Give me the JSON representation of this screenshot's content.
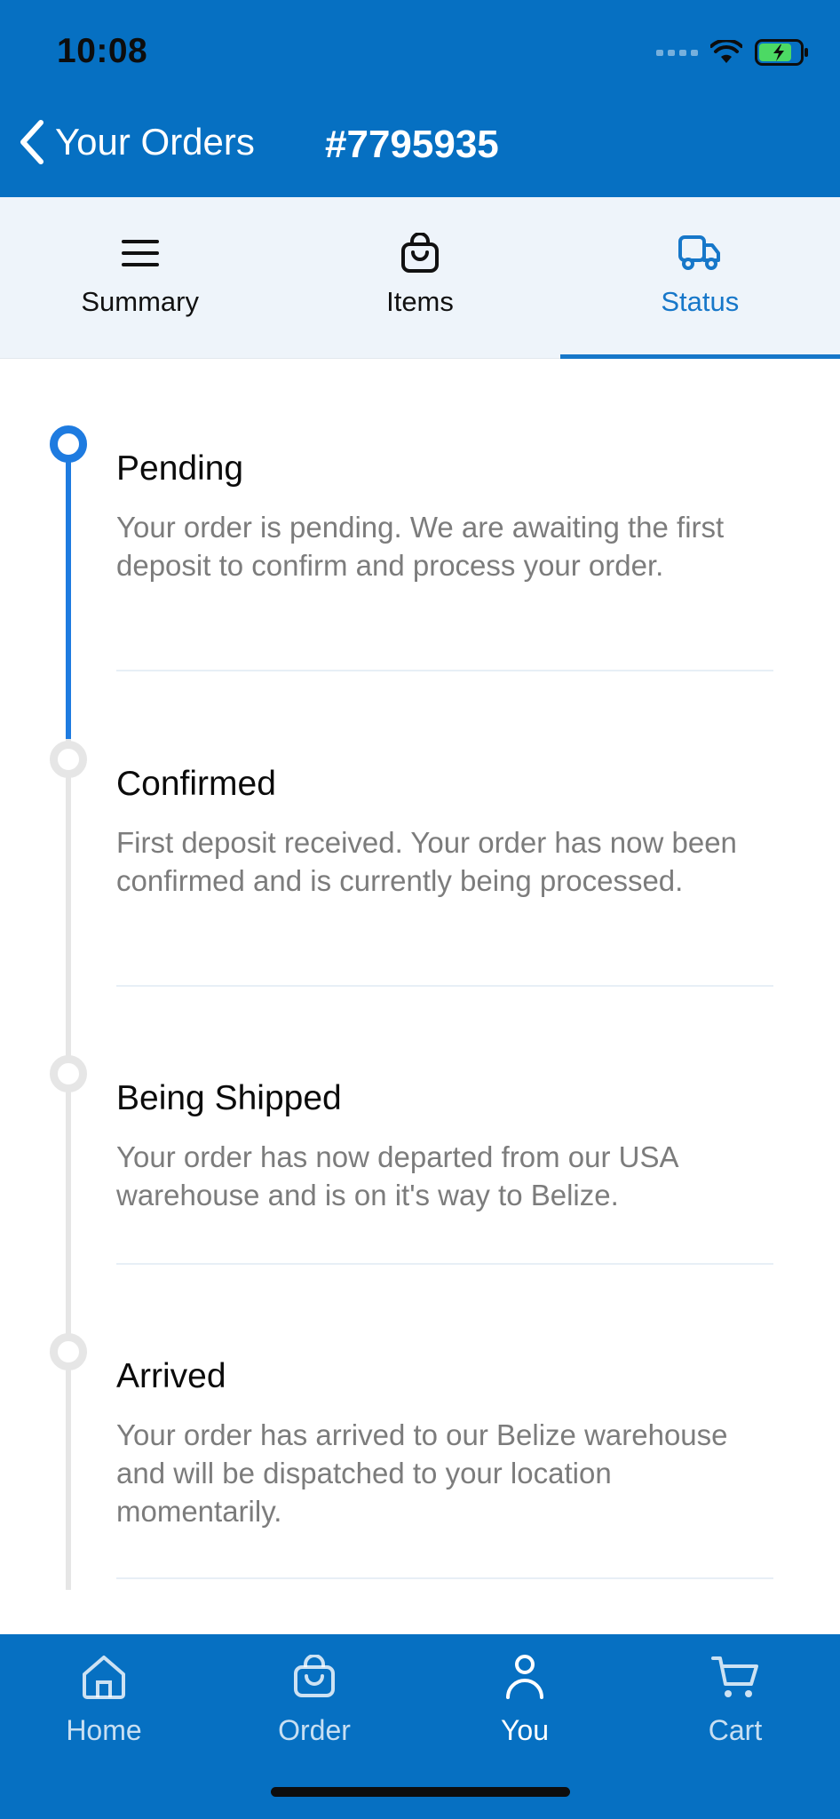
{
  "status_bar": {
    "time": "10:08"
  },
  "header": {
    "back_label": "Your Orders",
    "order_number": "#7795935"
  },
  "tabs": [
    {
      "label": "Summary",
      "icon": "list-icon",
      "active": false
    },
    {
      "label": "Items",
      "icon": "bag-icon",
      "active": false
    },
    {
      "label": "Status",
      "icon": "truck-icon",
      "active": true
    }
  ],
  "timeline": [
    {
      "title": "Pending",
      "description": "Your order is pending. We are awaiting the first deposit to confirm and process your order.",
      "completed": true
    },
    {
      "title": "Confirmed",
      "description": "First deposit received. Your order has now been confirmed and is currently being processed.",
      "completed": false
    },
    {
      "title": "Being Shipped",
      "description": "Your order has now departed from our USA warehouse and is on it's way to Belize.",
      "completed": false
    },
    {
      "title": "Arrived",
      "description": "Your order has arrived to our Belize warehouse and will be dispatched to your location momentarily.",
      "completed": false
    }
  ],
  "bottom_nav": [
    {
      "label": "Home",
      "icon": "home-icon",
      "active": false
    },
    {
      "label": "Order",
      "icon": "bag-icon",
      "active": false
    },
    {
      "label": "You",
      "icon": "person-icon",
      "active": true
    },
    {
      "label": "Cart",
      "icon": "cart-icon",
      "active": false
    }
  ],
  "colors": {
    "header_blue": "#0670C2",
    "accent_blue": "#1677C9",
    "timeline_active": "#1E7BE0",
    "timeline_inactive": "#E6E6E6",
    "tab_background": "#EEF4FA"
  }
}
